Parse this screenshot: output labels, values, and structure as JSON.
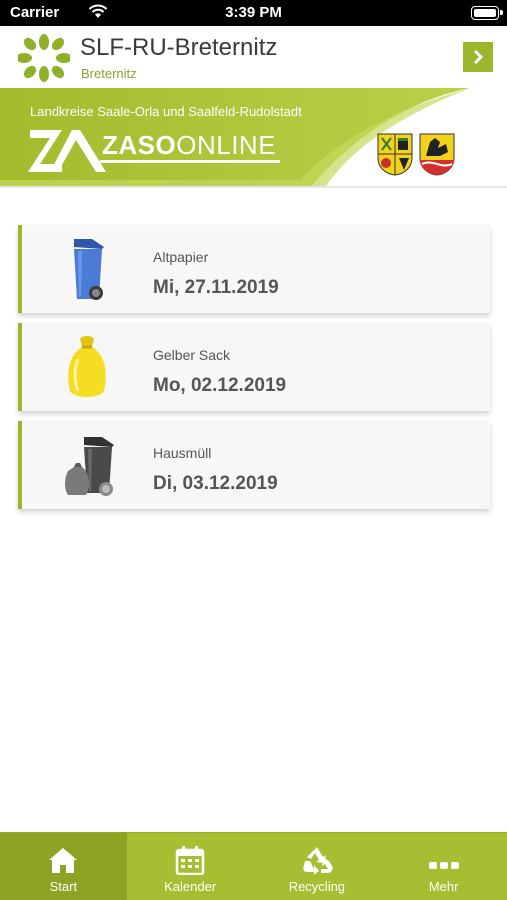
{
  "status_bar": {
    "carrier": "Carrier",
    "time": "3:39 PM",
    "battery_level": 1.0
  },
  "header": {
    "title": "SLF-RU-Breternitz",
    "subtitle": "Breternitz",
    "logo_icon": "leaf-flower-logo-icon",
    "next_icon": "chevron-right-icon"
  },
  "banner": {
    "region_text": "Landkreise Saale-Orla und Saalfeld-Rudolstadt",
    "brand_bold": "ZASO",
    "brand_light": "ONLINE",
    "brand_mark": "ZA",
    "coats_of_arms": [
      "coat-of-arms-saale-orla-icon",
      "coat-of-arms-saalfeld-rudolstadt-icon"
    ]
  },
  "pickups": [
    {
      "label": "Altpapier",
      "date": "Mi, 27.11.2019",
      "icon": "blue-bin-icon",
      "color": "#3d6cc5"
    },
    {
      "label": "Gelber Sack",
      "date": "Mo, 02.12.2019",
      "icon": "yellow-sack-icon",
      "color": "#f0d817"
    },
    {
      "label": "Hausmüll",
      "date": "Di, 03.12.2019",
      "icon": "black-bin-icon",
      "color": "#444444"
    }
  ],
  "tabs": [
    {
      "label": "Start",
      "icon": "home-icon",
      "active": true
    },
    {
      "label": "Kalender",
      "icon": "calendar-icon",
      "active": false
    },
    {
      "label": "Recycling",
      "icon": "recycling-icon",
      "active": false
    },
    {
      "label": "Mehr",
      "icon": "more-dots-icon",
      "active": false
    }
  ],
  "colors": {
    "accent": "#9bb52d",
    "tab_bar": "#a6be32",
    "tab_active": "#8ea323",
    "subtitle": "#8aa12e"
  }
}
